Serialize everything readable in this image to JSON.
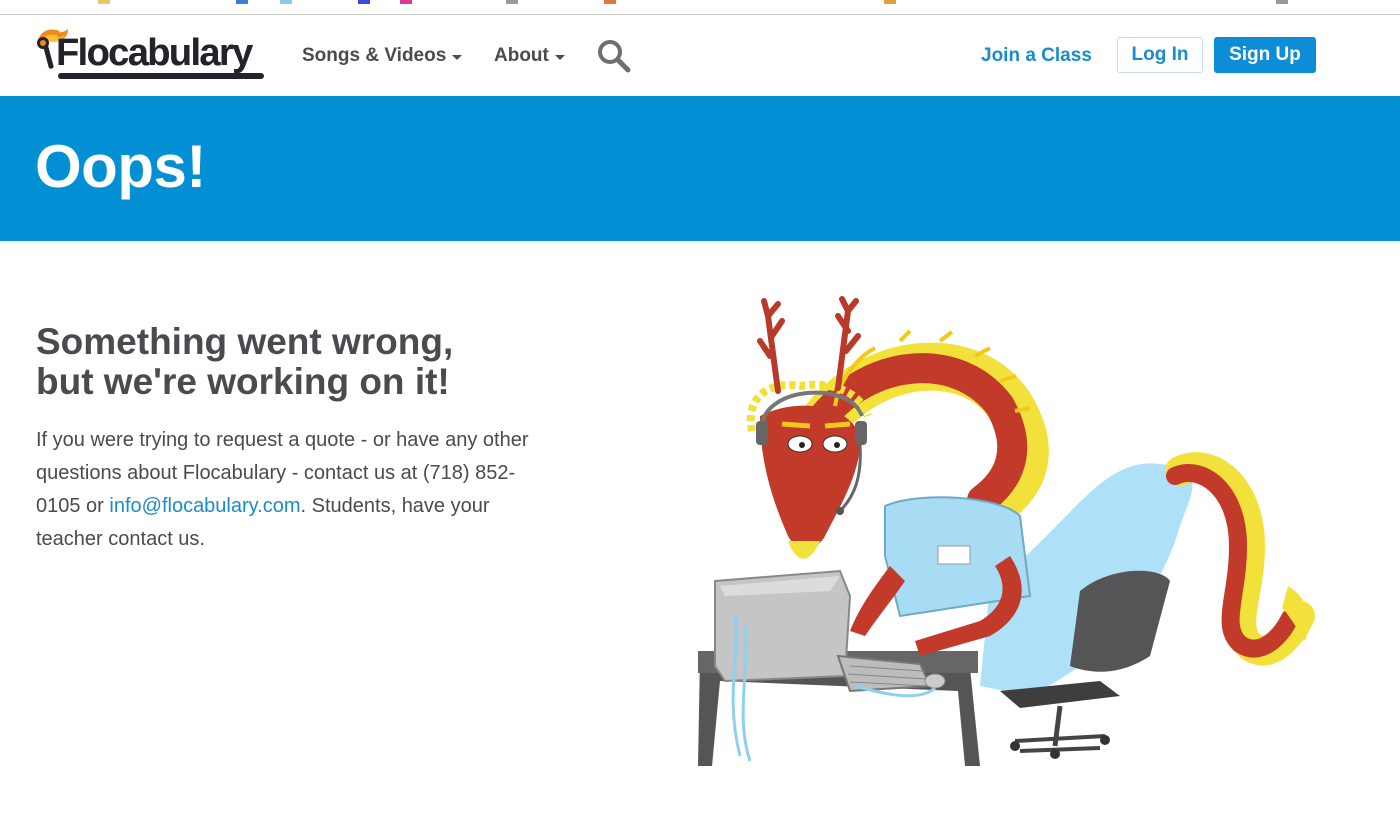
{
  "header": {
    "logo_text": "Flocabulary",
    "nav": [
      {
        "label": "Songs & Videos"
      },
      {
        "label": "About"
      }
    ],
    "join_label": "Join a Class",
    "login_label": "Log In",
    "signup_label": "Sign Up"
  },
  "hero": {
    "title": "Oops!"
  },
  "main": {
    "headline_line1": "Something went wrong,",
    "headline_line2": "but we're working on it!",
    "body_before": "If you were trying to request a quote - or have any other questions about Flocabulary - contact us at (718) 852-0105 or ",
    "email": "info@flocabulary.com",
    "body_after": ". Students, have your teacher contact us."
  },
  "colors": {
    "brand_blue": "#028fd4",
    "link_blue": "#1a8ccc",
    "text_dark": "#4a4a4f"
  },
  "icons": [
    "flame-logo-icon",
    "search-icon",
    "caret-down-icon"
  ]
}
